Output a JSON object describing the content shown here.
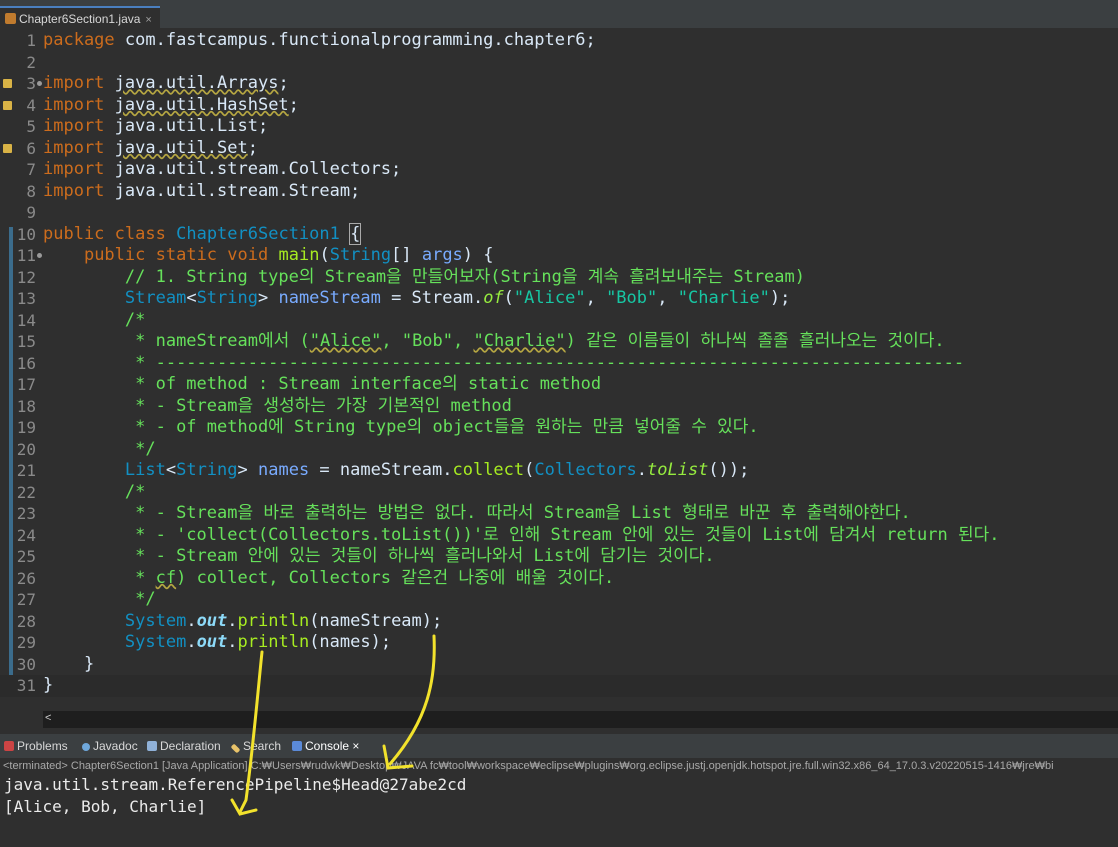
{
  "editor_tab": {
    "title": "Chapter6Section1.java",
    "close": "×"
  },
  "code": {
    "l1_kw": "package",
    "l1_rest": " com.fastcampus.functionalprogramming.chapter6;",
    "imports": [
      "java.util.Arrays;",
      "java.util.HashSet;",
      "java.util.List;",
      "java.util.Set;",
      "java.util.stream.Collectors;",
      "java.util.stream.Stream;"
    ],
    "import_kw": "import",
    "class_decl": [
      "public",
      "class",
      "Chapter6Section1",
      "{"
    ],
    "main_decl": [
      "public",
      "static",
      "void",
      "main",
      "String",
      "args"
    ],
    "c12": "// 1. String type의 Stream을 만들어보자(String을 계속 흘려보내주는 Stream)",
    "l13": {
      "type": "Stream",
      "gen": "String",
      "var": "nameStream",
      "call_cls": "Stream",
      "method": "of",
      "args": [
        "\"Alice\"",
        "\"Bob\"",
        "\"Charlie\""
      ]
    },
    "c14": "/*",
    "c15a": " * nameStream에서 (",
    "c15b": "\"Alice\"",
    "c15c": ", \"Bob\", ",
    "c15d": "\"Charlie\"",
    "c15e": ") 같은 이름들이 하나씩 졸졸 흘러나오는 것이다.",
    "c16": " * -------------------------------------------------------------------------------",
    "c17": " * of method : Stream interface의 static method",
    "c18": " * - Stream을 생성하는 가장 기본적인 method",
    "c19": " * - of method에 String type의 object들을 원하는 만큼 넣어줄 수 있다.",
    "c20": " */",
    "l21": {
      "type": "List",
      "gen": "String",
      "var": "names",
      "obj": "nameStream",
      "method": "collect",
      "cls": "Collectors",
      "inner": "toList"
    },
    "c22": "/*",
    "c23": " * - Stream을 바로 출력하는 방법은 없다. 따라서 Stream을 List 형태로 바꾼 후 출력해야한다.",
    "c24": " * - 'collect(Collectors.toList())'로 인해 Stream 안에 있는 것들이 List에 담겨서 return 된다.",
    "c25": " * - Stream 안에 있는 것들이 하나씩 흘러나와서 List에 담기는 것이다.",
    "c26a": " * ",
    "c26b": "cf",
    "c26c": ") collect, Collectors 같은건 나중에 배울 것이다.",
    "c27": " */",
    "l28": {
      "cls": "System",
      "fld": "out",
      "method": "println",
      "arg": "nameStream"
    },
    "l29": {
      "cls": "System",
      "fld": "out",
      "method": "println",
      "arg": "names"
    },
    "close_brace": "}"
  },
  "line_numbers": [
    "1",
    "2",
    "3",
    "4",
    "5",
    "6",
    "7",
    "8",
    "9",
    "10",
    "11",
    "12",
    "13",
    "14",
    "15",
    "16",
    "17",
    "18",
    "19",
    "20",
    "21",
    "22",
    "23",
    "24",
    "25",
    "26",
    "27",
    "28",
    "29",
    "30",
    "31"
  ],
  "scroll_arrow": "<",
  "panel_tabs": [
    "Problems",
    "Javadoc",
    "Declaration",
    "Search",
    "Console"
  ],
  "panel_close": "×",
  "terminated_text": "<terminated> Chapter6Section1 [Java Application] C:₩Users₩rudwk₩Desktop₩JAVA fc₩tool₩workspace₩eclipse₩plugins₩org.eclipse.justj.openjdk.hotspot.jre.full.win32.x86_64_17.0.3.v20220515-1416₩jre₩bi",
  "console_lines": [
    "java.util.stream.ReferencePipeline$Head@27abe2cd",
    "[Alice, Bob, Charlie]"
  ],
  "colors": {
    "keyword": "#cc6c1d",
    "type": "#1290c3",
    "string": "#17c6a3",
    "comment": "#66e15b",
    "annotation_arrow": "#f2e22c"
  }
}
